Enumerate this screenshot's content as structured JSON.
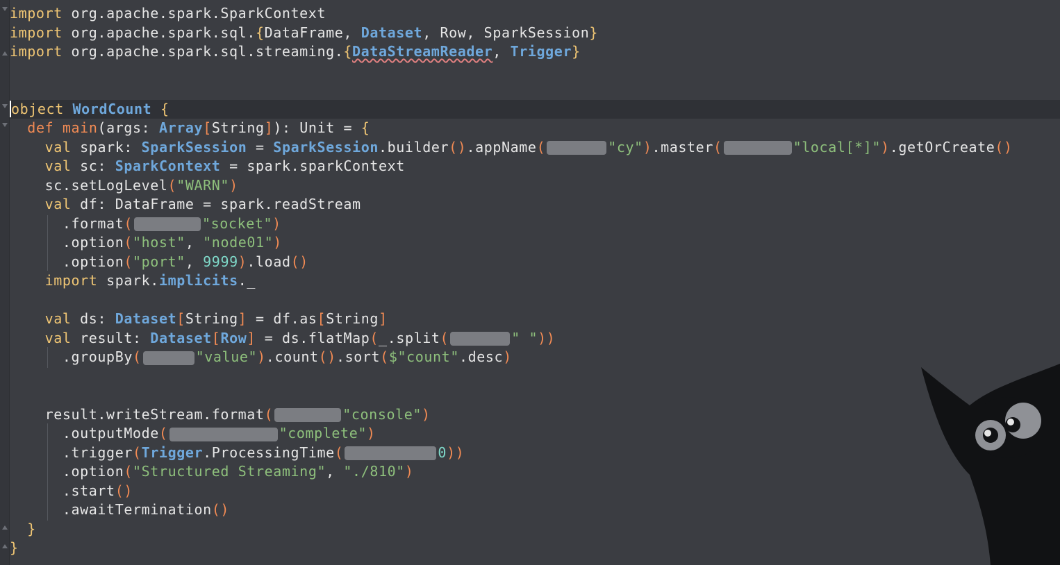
{
  "editor": {
    "lines": [
      [
        [
          "kw",
          "import"
        ],
        [
          "pl",
          " org.apache.spark.SparkContext"
        ]
      ],
      [
        [
          "kw",
          "import"
        ],
        [
          "pl",
          " org.apache.spark.sql."
        ],
        [
          "kw",
          "{"
        ],
        [
          "pl",
          "DataFrame, "
        ],
        [
          "type",
          "Dataset"
        ],
        [
          "pl",
          ", Row, SparkSession"
        ],
        [
          "kw",
          "}"
        ]
      ],
      [
        [
          "kw",
          "import"
        ],
        [
          "pl",
          " org.apache.spark.sql.streaming."
        ],
        [
          "kw",
          "{"
        ],
        [
          "type",
          "DataStreamReader"
        ],
        [
          "pl",
          ", "
        ],
        [
          "type",
          "Trigger"
        ],
        [
          "kw",
          "}"
        ]
      ],
      [],
      [],
      [
        [
          "kw",
          "object"
        ],
        [
          "pl",
          " "
        ],
        [
          "type",
          "WordCount"
        ],
        [
          "pl",
          " "
        ],
        [
          "kw",
          "{"
        ]
      ],
      [
        [
          "pl",
          "  "
        ],
        [
          "fn",
          "def"
        ],
        [
          "pl",
          " "
        ],
        [
          "fn",
          "main"
        ],
        [
          "pl",
          "(args: "
        ],
        [
          "type",
          "Array"
        ],
        [
          "br",
          "["
        ],
        [
          "pl",
          "String"
        ],
        [
          "br",
          "]"
        ],
        [
          "pl",
          "): Unit = "
        ],
        [
          "kw",
          "{"
        ]
      ],
      [
        [
          "pl",
          "    "
        ],
        [
          "kw",
          "val"
        ],
        [
          "pl",
          " spark: "
        ],
        [
          "type",
          "SparkSession"
        ],
        [
          "pl",
          " = "
        ],
        [
          "type",
          "SparkSession"
        ],
        [
          "pl",
          ".builder"
        ],
        [
          "br",
          "()"
        ],
        [
          "pl",
          ".appName"
        ],
        [
          "br",
          "("
        ],
        [
          "hint",
          ""
        ],
        [
          "str",
          "\"cy\""
        ],
        [
          "br",
          ")"
        ],
        [
          "pl",
          ".master"
        ],
        [
          "br",
          "("
        ],
        [
          "hint",
          ""
        ],
        [
          "str",
          "\"local[*]\""
        ],
        [
          "br",
          ")"
        ],
        [
          "pl",
          ".getOrCreate"
        ],
        [
          "br",
          "()"
        ]
      ],
      [
        [
          "pl",
          "    "
        ],
        [
          "kw",
          "val"
        ],
        [
          "pl",
          " sc: "
        ],
        [
          "type",
          "SparkContext"
        ],
        [
          "pl",
          " = spark.sparkContext"
        ]
      ],
      [
        [
          "pl",
          "    sc.setLogLevel"
        ],
        [
          "br",
          "("
        ],
        [
          "str",
          "\"WARN\""
        ],
        [
          "br",
          ")"
        ]
      ],
      [
        [
          "pl",
          "    "
        ],
        [
          "kw",
          "val"
        ],
        [
          "pl",
          " df: DataFrame = spark.readStream"
        ]
      ],
      [
        [
          "pl",
          "      .format"
        ],
        [
          "br",
          "("
        ],
        [
          "hint",
          ""
        ],
        [
          "str",
          "\"socket\""
        ],
        [
          "br",
          ")"
        ]
      ],
      [
        [
          "pl",
          "      .option"
        ],
        [
          "br",
          "("
        ],
        [
          "str",
          "\"host\""
        ],
        [
          "pl",
          ", "
        ],
        [
          "str",
          "\"node01\""
        ],
        [
          "br",
          ")"
        ]
      ],
      [
        [
          "pl",
          "      .option"
        ],
        [
          "br",
          "("
        ],
        [
          "str",
          "\"port\""
        ],
        [
          "pl",
          ", "
        ],
        [
          "num",
          "9999"
        ],
        [
          "br",
          ")"
        ],
        [
          "pl",
          ".load"
        ],
        [
          "br",
          "()"
        ]
      ],
      [
        [
          "pl",
          "    "
        ],
        [
          "kw",
          "import"
        ],
        [
          "pl",
          " spark."
        ],
        [
          "type",
          "implicits"
        ],
        [
          "pl",
          "._"
        ]
      ],
      [],
      [
        [
          "pl",
          "    "
        ],
        [
          "kw",
          "val"
        ],
        [
          "pl",
          " ds: "
        ],
        [
          "type",
          "Dataset"
        ],
        [
          "br",
          "["
        ],
        [
          "pl",
          "String"
        ],
        [
          "br",
          "]"
        ],
        [
          "pl",
          " = df.as"
        ],
        [
          "br",
          "["
        ],
        [
          "pl",
          "String"
        ],
        [
          "br",
          "]"
        ]
      ],
      [
        [
          "pl",
          "    "
        ],
        [
          "kw",
          "val"
        ],
        [
          "pl",
          " result: "
        ],
        [
          "type",
          "Dataset"
        ],
        [
          "br",
          "["
        ],
        [
          "type",
          "Row"
        ],
        [
          "br",
          "]"
        ],
        [
          "pl",
          " = ds.flatMap"
        ],
        [
          "br",
          "("
        ],
        [
          "pl",
          "_.split"
        ],
        [
          "br",
          "("
        ],
        [
          "hint",
          ""
        ],
        [
          "str",
          "\" \""
        ],
        [
          "br",
          "))"
        ]
      ],
      [
        [
          "pl",
          "      .groupBy"
        ],
        [
          "br",
          "("
        ],
        [
          "hint",
          ""
        ],
        [
          "str",
          "\"value\""
        ],
        [
          "br",
          ")"
        ],
        [
          "pl",
          ".count"
        ],
        [
          "br",
          "()"
        ],
        [
          "pl",
          ".sort"
        ],
        [
          "br",
          "("
        ],
        [
          "str",
          "$\"count\""
        ],
        [
          "pl",
          ".desc"
        ],
        [
          "br",
          ")"
        ]
      ],
      [],
      [],
      [
        [
          "pl",
          "    result.writeStream.format"
        ],
        [
          "br",
          "("
        ],
        [
          "hint",
          ""
        ],
        [
          "str",
          "\"console\""
        ],
        [
          "br",
          ")"
        ]
      ],
      [
        [
          "pl",
          "      .outputMode"
        ],
        [
          "br",
          "("
        ],
        [
          "hint",
          ""
        ],
        [
          "str",
          "\"complete\""
        ],
        [
          "br",
          ")"
        ]
      ],
      [
        [
          "pl",
          "      .trigger"
        ],
        [
          "br",
          "("
        ],
        [
          "type",
          "Trigger"
        ],
        [
          "pl",
          ".ProcessingTime"
        ],
        [
          "br",
          "("
        ],
        [
          "hint",
          ""
        ],
        [
          "num",
          "0"
        ],
        [
          "br",
          "))"
        ]
      ],
      [
        [
          "pl",
          "      .option"
        ],
        [
          "br",
          "("
        ],
        [
          "str",
          "\"Structured Streaming\""
        ],
        [
          "pl",
          ", "
        ],
        [
          "str",
          "\"./810\""
        ],
        [
          "br",
          ")"
        ]
      ],
      [
        [
          "pl",
          "      .start"
        ],
        [
          "br",
          "()"
        ]
      ],
      [
        [
          "pl",
          "      .awaitTermination"
        ],
        [
          "br",
          "()"
        ]
      ],
      [
        [
          "pl",
          "  "
        ],
        [
          "kw",
          "}"
        ]
      ],
      [
        [
          "kw",
          "}"
        ]
      ]
    ],
    "current_line": 5,
    "underlined_token": "DataStreamReader"
  },
  "colors": {
    "background": "#3b3d42",
    "keyword": "#f0c674",
    "type": "#6fa8dc",
    "string": "#8ec07c",
    "number": "#7fd9c9",
    "bracket": "#f28b54"
  },
  "icons": {
    "mascot": "black-cat-mascot"
  }
}
